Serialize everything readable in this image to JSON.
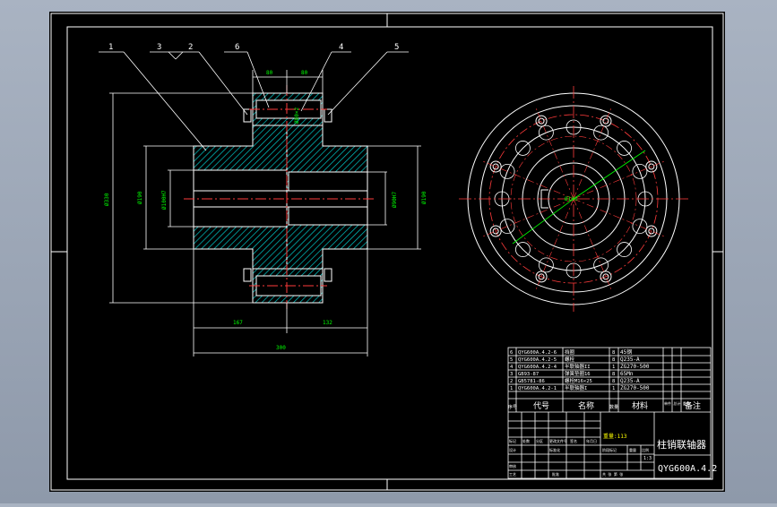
{
  "canvas": {
    "background": "#000000",
    "frame_color": "#ffffff"
  },
  "colors": {
    "outline": "#ffffff",
    "hatch": "#00cccc",
    "centerline": "#ff3b3b",
    "dimension": "#00ff00",
    "leader": "#ffffff",
    "bolt_circle": "#ffff00"
  },
  "balloons": [
    "1",
    "3",
    "2",
    "6",
    "4",
    "5"
  ],
  "section_view": {
    "dimensions": {
      "top_left": "80",
      "top_right": "80",
      "left_outer": "Ø330",
      "left_inner": "Ø190",
      "bore_left": "Ø100H7",
      "bore_right": "Ø90H7",
      "right_side": "Ø190",
      "pin": "Ø80×2",
      "bottom_left": "167",
      "bottom_right": "132",
      "overall": "300"
    }
  },
  "end_view": {
    "center_label": "Ø100"
  },
  "parts_list": {
    "rows": [
      {
        "no": "6",
        "code": "QYG600A.4.2-6",
        "name": "挡圈",
        "qty": "8",
        "material": "45钢"
      },
      {
        "no": "5",
        "code": "QYG600A.4.2-5",
        "name": "螺栓",
        "qty": "8",
        "material": "Q235-A"
      },
      {
        "no": "4",
        "code": "QYG600A.4.2-4",
        "name": "半联轴器II",
        "qty": "1",
        "material": "ZG270-500"
      },
      {
        "no": "3",
        "code": "GB93-87",
        "name": "弹簧垫圈16",
        "qty": "8",
        "material": "65Mn"
      },
      {
        "no": "2",
        "code": "GB5781-86",
        "name": "螺栓M16×25",
        "qty": "8",
        "material": "Q235-A"
      },
      {
        "no": "1",
        "code": "QYG600A.4.2-1",
        "name": "半联轴器I",
        "qty": "1",
        "material": "ZG270-500"
      }
    ],
    "header": {
      "no": "序号",
      "code": "代号",
      "name": "名称",
      "qty": "数量",
      "material": "材料",
      "weight": "单件 总计 重量",
      "remarks": "备注"
    }
  },
  "title_block": {
    "title": "柱销联轴器",
    "drawing_no": "QYG600A.4.2",
    "mass_label": "重量:113",
    "scale": "1:3",
    "row_labels": [
      "标记",
      "处数",
      "分区",
      "更改文件号",
      "签名",
      "年月日"
    ],
    "design": "设计",
    "standard": "标准化",
    "check": "审核",
    "process": "工艺",
    "approve": "批准",
    "stage_mark": "阶段标记",
    "weight_col": "重量",
    "scale_col": "比例",
    "sheets": "共 张 第 张"
  }
}
